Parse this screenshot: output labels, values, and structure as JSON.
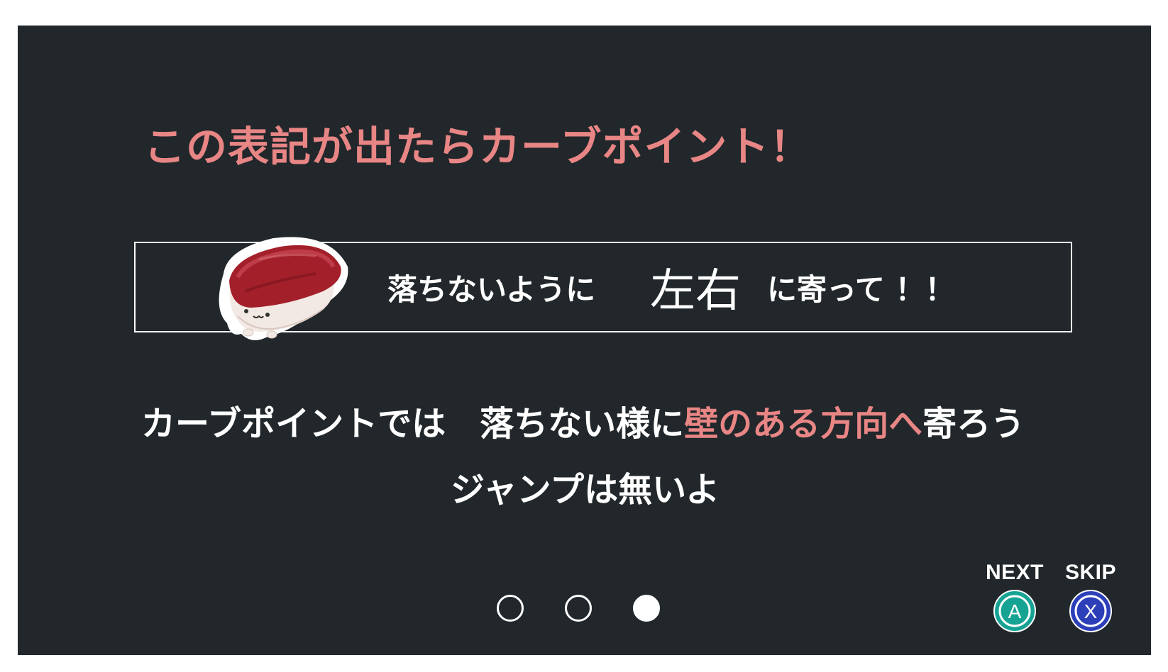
{
  "heading": "この表記が出たらカーブポイント！",
  "banner": {
    "text_before": "落ちないように",
    "direction": "左右",
    "text_after": "に寄って ！！"
  },
  "body": {
    "line1_part1": "カーブポイントでは",
    "line1_part2": "落ちない様に",
    "line1_highlight": "壁のある方向へ",
    "line1_part3": "寄ろう",
    "line2": "ジャンプは無いよ"
  },
  "pagination": {
    "total": 3,
    "current": 3
  },
  "controls": {
    "next_label": "NEXT",
    "next_button": "A",
    "skip_label": "SKIP",
    "skip_button": "X"
  },
  "colors": {
    "background": "#21272a",
    "accent": "#e88585",
    "a_button": "#16a394",
    "x_button": "#2d3fb8"
  }
}
